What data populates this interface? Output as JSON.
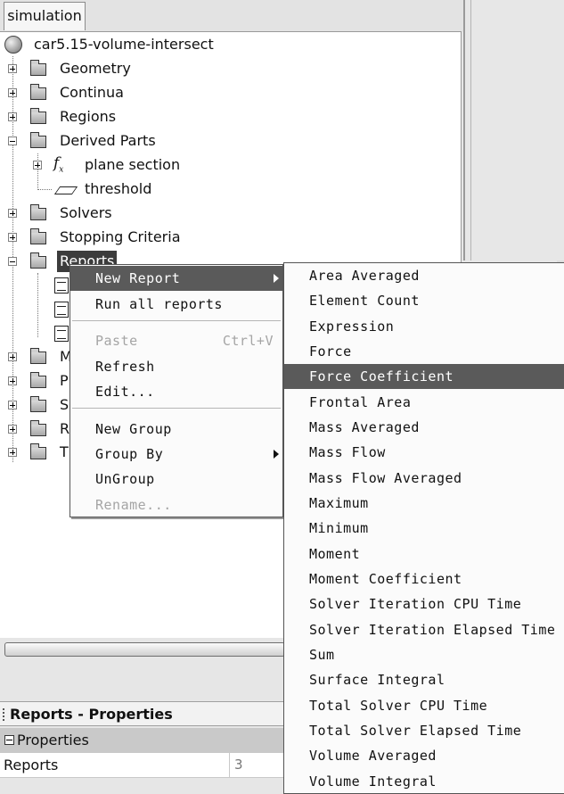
{
  "tab": {
    "label": "simulation"
  },
  "tree": {
    "root": "car5.15-volume-intersect",
    "items": [
      "Geometry",
      "Continua",
      "Regions",
      "Derived Parts"
    ],
    "derived_parts": [
      "plane section",
      "threshold"
    ],
    "items2": [
      "Solvers",
      "Stopping Criteria",
      "Reports"
    ],
    "partial_items": [
      "M",
      "P",
      "S",
      "R",
      "T"
    ]
  },
  "context_menu": {
    "new_report": "New Report",
    "run_all": "Run all reports",
    "paste": "Paste",
    "paste_shortcut": "Ctrl+V",
    "refresh": "Refresh",
    "edit": "Edit...",
    "new_group": "New Group",
    "group_by": "Group By",
    "ungroup": "UnGroup",
    "rename": "Rename..."
  },
  "submenu": {
    "items": [
      "Area Averaged",
      "Element Count",
      "Expression",
      "Force",
      "Force Coefficient",
      "Frontal Area",
      "Mass Averaged",
      "Mass Flow",
      "Mass Flow Averaged",
      "Maximum",
      "Minimum",
      "Moment",
      "Moment Coefficient",
      "Solver Iteration CPU Time",
      "Solver Iteration Elapsed Time",
      "Sum",
      "Surface Integral",
      "Total Solver CPU Time",
      "Total Solver Elapsed Time",
      "Volume Averaged",
      "Volume Integral"
    ],
    "highlighted": "Force Coefficient"
  },
  "properties": {
    "title": "Reports - Properties",
    "group": "Properties",
    "rows": [
      {
        "name": "Reports",
        "value": "3"
      }
    ]
  },
  "colors": {
    "highlight": "#5a5a5a",
    "selection": "#3c3c3c",
    "menu_bg": "#fbfbfb"
  }
}
